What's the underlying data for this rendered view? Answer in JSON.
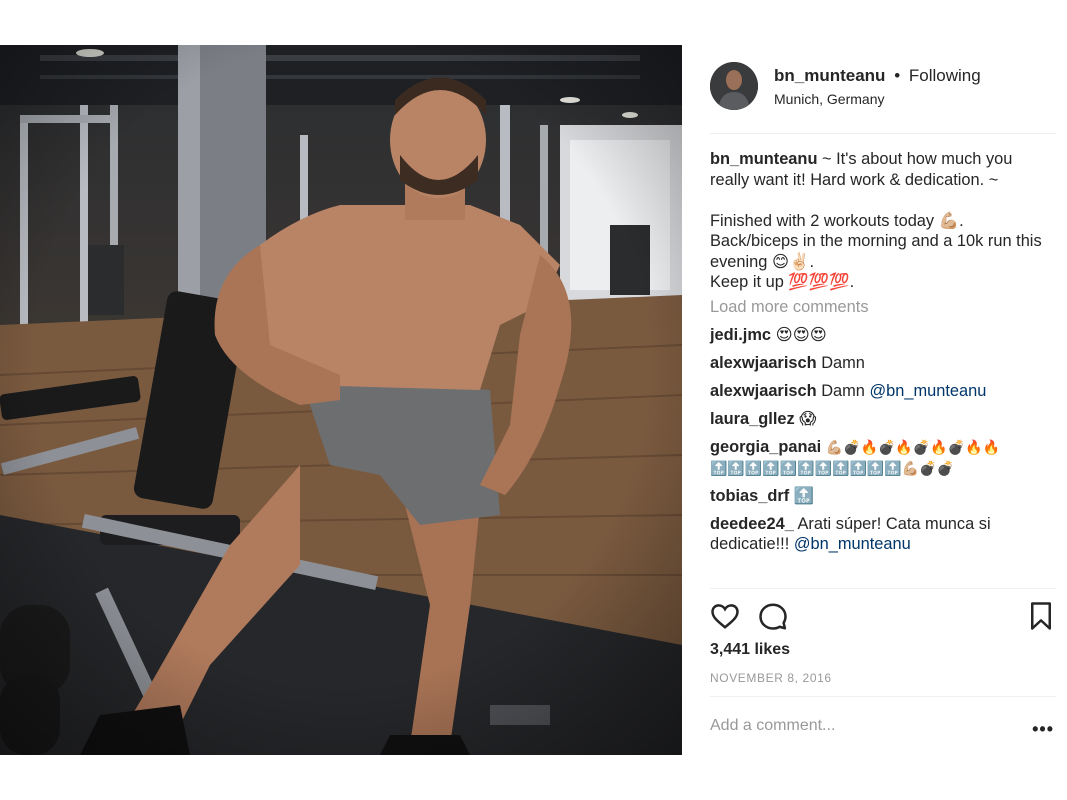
{
  "header": {
    "username": "bn_munteanu",
    "separator": "•",
    "follow_status": "Following",
    "location": "Munich, Germany"
  },
  "caption": {
    "username": "bn_munteanu",
    "line1": " ~ It's about how much you really want it! Hard work & dedication. ~",
    "line2": "Finished with 2 workouts today 💪🏼.",
    "line3": "Back/biceps in the morning and a 10k run this evening 😊✌🏻.",
    "line4": "Keep it up 💯💯💯."
  },
  "load_more": "Load more comments",
  "comments": [
    {
      "user": "jedi.jmc",
      "text": "😍😍😍"
    },
    {
      "user": "alexwjaarisch",
      "text": "Damn"
    },
    {
      "user": "alexwjaarisch",
      "text": "Damn ",
      "mention": "@bn_munteanu"
    },
    {
      "user": "laura_gllez",
      "text": "😱"
    },
    {
      "user": "georgia_panai",
      "text": "💪🏼💣🔥💣🔥💣🔥💣🔥🔥 🔝🔝🔝🔝🔝🔝🔝🔝🔝🔝🔝💪🏼💣💣"
    },
    {
      "user": "tobias_drf",
      "text": "🔝"
    },
    {
      "user": "deedee24_",
      "text": "Arati súper! Cata munca si dedicatie!!! ",
      "mention": "@bn_munteanu"
    }
  ],
  "actions": {
    "like_icon": "heart-icon",
    "comment_icon": "comment-bubble-icon",
    "save_icon": "bookmark-icon"
  },
  "likes": "3,441 likes",
  "date": "NOVEMBER 8, 2016",
  "add_comment": {
    "placeholder": "Add a comment..."
  },
  "more_options": "•••"
}
